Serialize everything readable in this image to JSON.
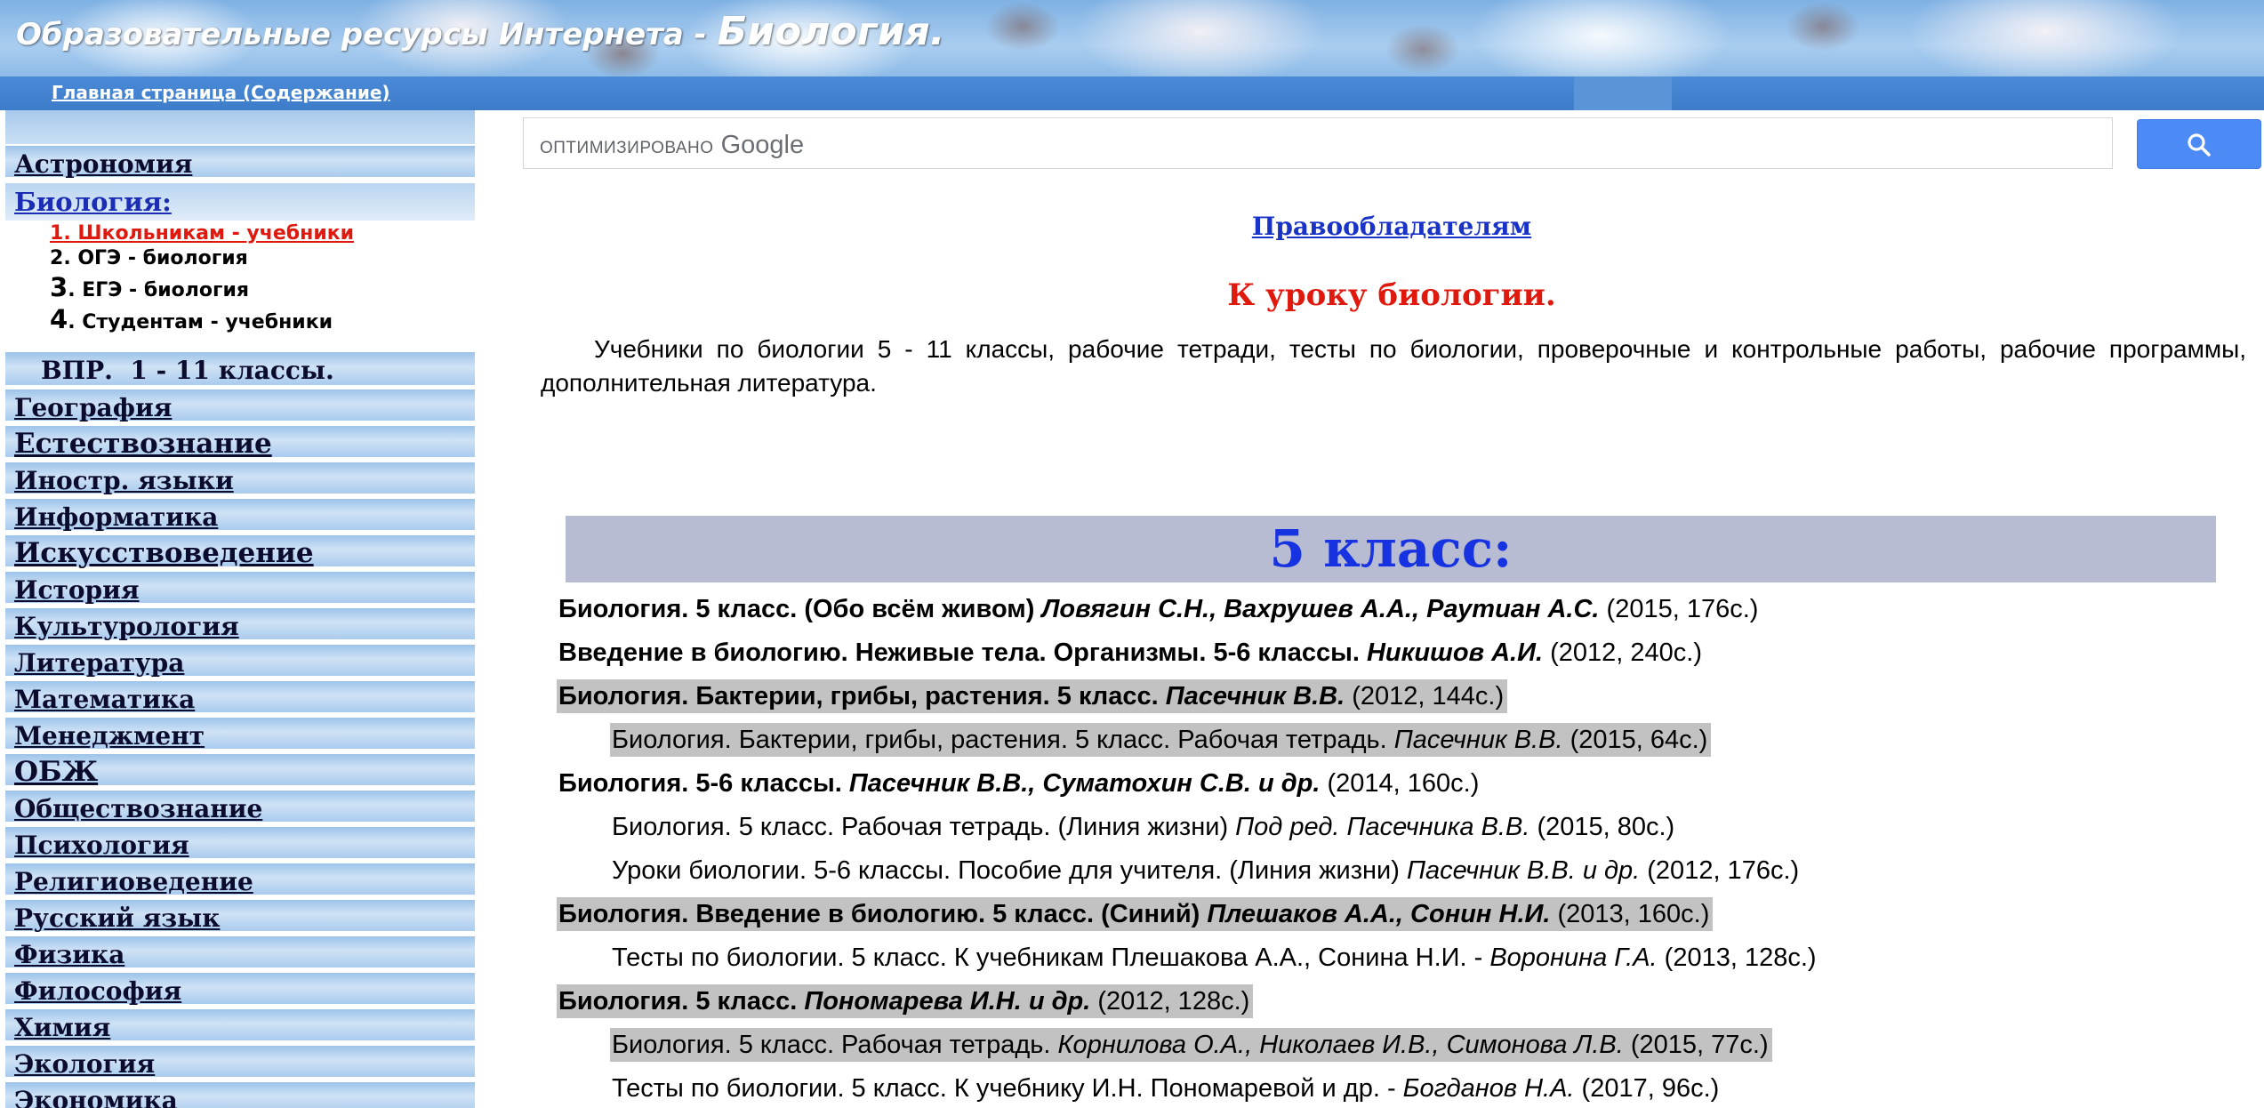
{
  "header": {
    "title_part1": "Образовательные ресурсы Интернета - ",
    "title_part2": "Биология."
  },
  "navbar": {
    "home_link": "Главная страница (Содержание)"
  },
  "sidebar": {
    "items_before": [
      {
        "label": "Астрономия"
      }
    ],
    "biology": {
      "title": "Биология:",
      "subitems": [
        {
          "num": "1",
          "label": ". Школьникам - учебники",
          "active": true
        },
        {
          "num": "2",
          "label": ". ОГЭ - биология"
        },
        {
          "num": "3",
          "label": ". ЕГЭ - биология"
        },
        {
          "num": "4",
          "label": ". Студентам - учебники"
        }
      ]
    },
    "vpr": "ВПР.  1 - 11 классы.",
    "items": [
      {
        "label": "География"
      },
      {
        "label": "Естествознание"
      },
      {
        "label": "Иностр. языки"
      },
      {
        "label": "Информатика"
      },
      {
        "label": "Искусствоведение"
      },
      {
        "label": "История"
      },
      {
        "label": "Культурология"
      },
      {
        "label": "Литература"
      },
      {
        "label": "Математика"
      },
      {
        "label": "Менеджмент"
      },
      {
        "label": "ОБЖ"
      },
      {
        "label": "Обществознание"
      },
      {
        "label": "Психология"
      },
      {
        "label": "Религиоведение"
      },
      {
        "label": "Русский язык"
      },
      {
        "label": "Физика"
      },
      {
        "label": "Философия"
      },
      {
        "label": "Химия"
      },
      {
        "label": "Экология"
      },
      {
        "label": "Экономика"
      }
    ]
  },
  "search": {
    "placeholder_prefix": "ОПТИМИЗИРОВАНО",
    "placeholder_brand": "Google",
    "button_icon": "search-icon"
  },
  "main": {
    "rights_link": "Правообладателям",
    "heading": "К уроку биологии.",
    "intro": "Учебники по биологии 5 - 11 классы, рабочие тетради, тесты по биологии, проверочные и контрольные работы, рабочие программы, дополнительная литература.",
    "grade_title": "5 класс:",
    "books": [
      {
        "kind": "main",
        "hl": false,
        "title": "Биология. 5 класс. (Обо всём живом) ",
        "author": "Ловягин С.Н., Вахрушев А.А., Раутиан А.С.",
        "info": " (2015, 176с.)"
      },
      {
        "kind": "main",
        "hl": false,
        "title": "Введение в биологию. Неживые тела. Организмы. 5-6 классы. ",
        "author": "Никишов А.И.",
        "info": " (2012, 240с.)"
      },
      {
        "kind": "main",
        "hl": true,
        "title": "Биология. Бактерии, грибы, растения. 5 класс.  ",
        "author": "Пасечник В.В.",
        "info": " (2012, 144с.)"
      },
      {
        "kind": "sub",
        "hl": true,
        "title": "Биология. Бактерии, грибы, растения. 5 класс. Рабочая тетрадь. ",
        "author": "Пасечник В.В.",
        "info": " (2015, 64с.)"
      },
      {
        "kind": "main",
        "hl": false,
        "title": "Биология. 5-6 классы.  ",
        "author": "Пасечник В.В., Суматохин С.В. и др.",
        "info": " (2014, 160с.)"
      },
      {
        "kind": "sub",
        "hl": false,
        "title": "Биология. 5 класс. Рабочая тетрадь. (Линия жизни) ",
        "author": "Под ред. Пасечника В.В.",
        "info": " (2015, 80с.)"
      },
      {
        "kind": "sub",
        "hl": false,
        "title": "Уроки биологии. 5-6 классы. Пособие для учителя. (Линия жизни) ",
        "author": "Пасечник В.В. и др.",
        "info": " (2012, 176с.)"
      },
      {
        "kind": "main",
        "hl": true,
        "title": "Биология. Введение в биологию. 5 класс. (Синий)  ",
        "author": "Плешаков А.А., Сонин Н.И.",
        "info": " (2013, 160с.) "
      },
      {
        "kind": "sub",
        "hl": false,
        "title": "Тесты по биологии. 5 класс. К учебникам Плешакова А.А., Сонина Н.И. - ",
        "author": "Воронина Г.А.",
        "info": " (2013, 128с.)"
      },
      {
        "kind": "main",
        "hl": true,
        "title": "Биология. 5 класс. ",
        "author": "Пономарева И.Н. и др.",
        "info": " (2012, 128с.)"
      },
      {
        "kind": "sub",
        "hl": true,
        "title": "Биология. 5 класс. Рабочая тетрадь. ",
        "author": "Корнилова О.А., Николаев И.В., Симонова Л.В.",
        "info": " (2015, 77с.)"
      },
      {
        "kind": "sub",
        "hl": false,
        "title": "Тесты по биологии. 5 класс. К учебнику И.Н. Пономаревой и др. - ",
        "author": "Богданов Н.А.",
        "info": " (2017, 96с.)"
      }
    ]
  },
  "colors": {
    "header_blue": "#3c7cc9",
    "link_blue": "#1a33c7",
    "accent_red": "#e0190f",
    "grade_blue": "#1732e0",
    "grade_bar": "#b8bcd2",
    "highlight_gray": "#c2c2c2"
  }
}
